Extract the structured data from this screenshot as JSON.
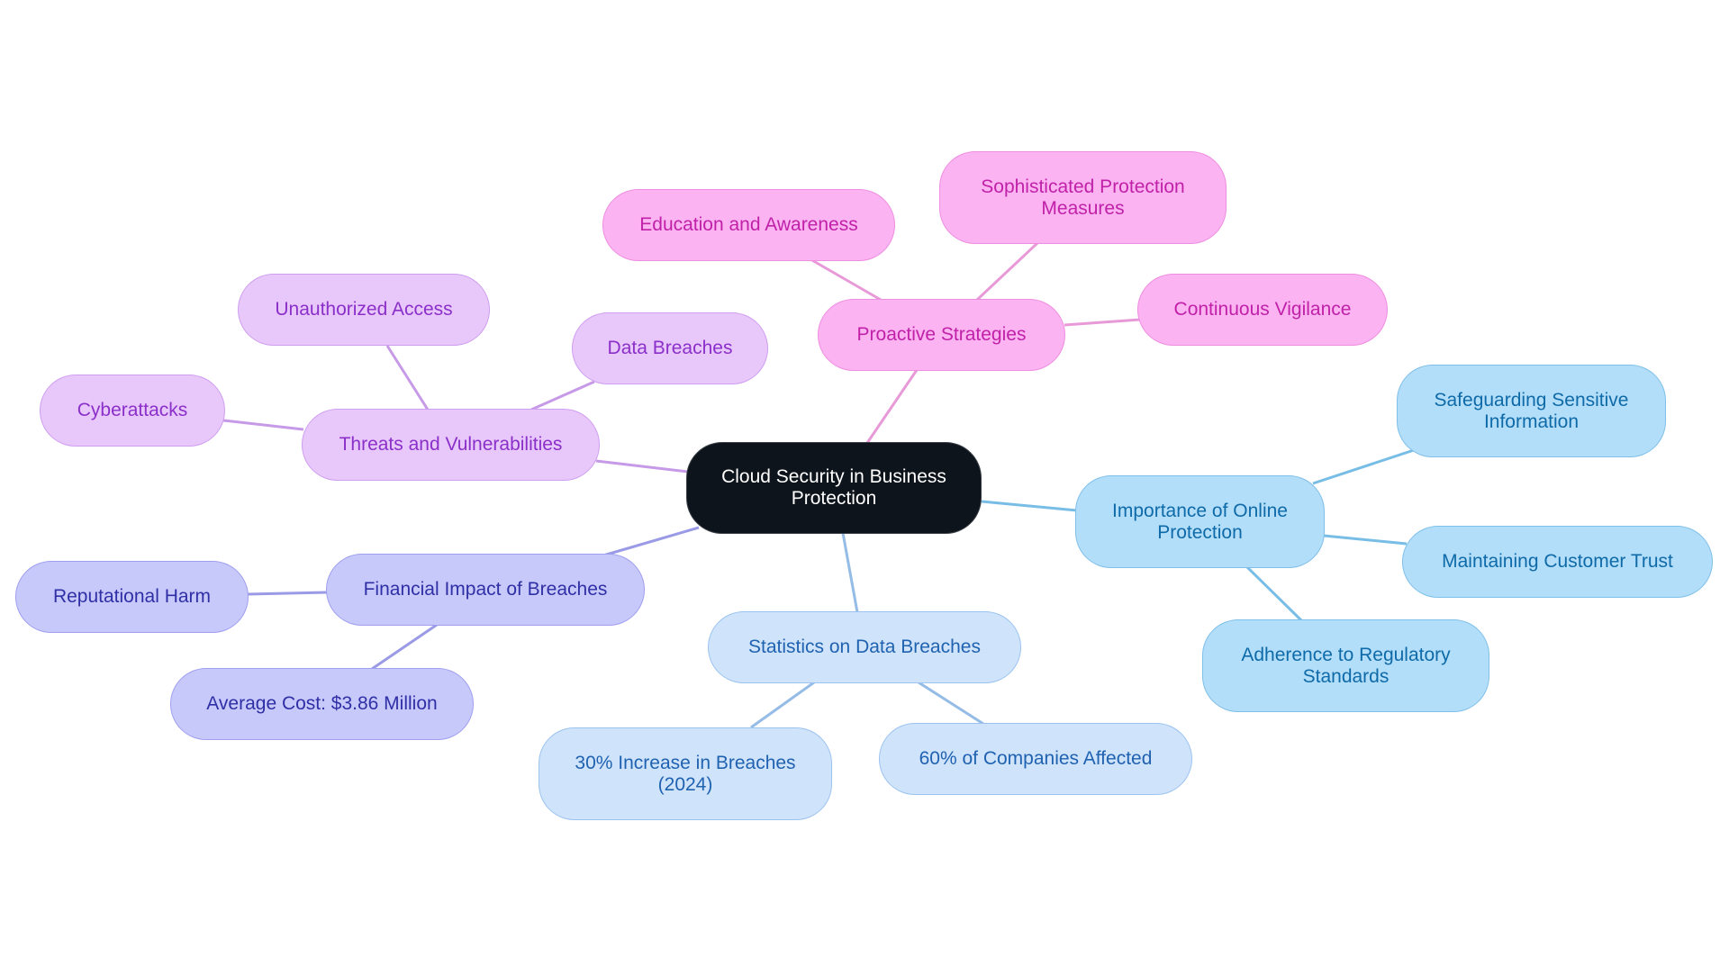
{
  "title": "Cloud Security in Business Protection",
  "colors": {
    "root": "#0e141b",
    "threats": "#e8c8fb",
    "strategies": "#fbb3f2",
    "financial": "#c8c9fb",
    "statistics": "#cfe3fb",
    "importance": "#b3def9",
    "edge_threats": "#c79ae8",
    "edge_strategies": "#e89ad8",
    "edge_financial": "#9a9ae6",
    "edge_statistics": "#94bce6",
    "edge_importance": "#78bde6"
  },
  "nodes": {
    "root": "Cloud Security in Business\nProtection",
    "threats": "Threats and Vulnerabilities",
    "unauthorized": "Unauthorized Access",
    "data_breaches": "Data Breaches",
    "cyberattacks": "Cyberattacks",
    "strategies": "Proactive Strategies",
    "education": "Education and Awareness",
    "sophisticated": "Sophisticated Protection\nMeasures",
    "vigilance": "Continuous Vigilance",
    "financial": "Financial Impact of Breaches",
    "reputational": "Reputational Harm",
    "average_cost": "Average Cost: $3.86 Million",
    "statistics": "Statistics on Data Breaches",
    "increase": "30% Increase in Breaches\n(2024)",
    "companies": "60% of Companies Affected",
    "importance": "Importance of Online\nProtection",
    "safeguarding": "Safeguarding Sensitive\nInformation",
    "trust": "Maintaining Customer Trust",
    "regulatory": "Adherence to Regulatory\nStandards"
  }
}
